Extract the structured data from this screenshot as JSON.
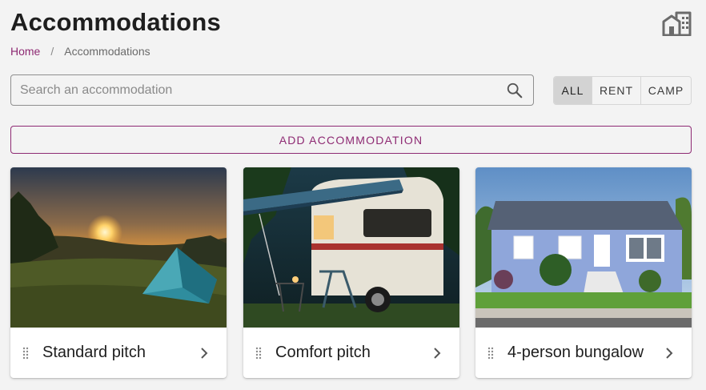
{
  "header": {
    "title": "Accommodations",
    "icon": "buildings-icon"
  },
  "breadcrumb": {
    "home": "Home",
    "separator": "/",
    "current": "Accommodations"
  },
  "search": {
    "placeholder": "Search an accommodation",
    "value": "",
    "icon": "search-icon"
  },
  "filters": {
    "items": [
      {
        "label": "ALL",
        "active": true
      },
      {
        "label": "RENT",
        "active": false
      },
      {
        "label": "CAMP",
        "active": false
      }
    ]
  },
  "add_button": {
    "label": "ADD ACCOMMODATION"
  },
  "cards": [
    {
      "title": "Standard pitch",
      "image": "tent-at-sunset-photo"
    },
    {
      "title": "Comfort pitch",
      "image": "caravan-with-awning-photo"
    },
    {
      "title": "4-person bungalow",
      "image": "blue-house-photo"
    }
  ],
  "colors": {
    "accent": "#8e2a73",
    "background": "#f3f3f3",
    "active_filter": "#d3d3d3"
  }
}
